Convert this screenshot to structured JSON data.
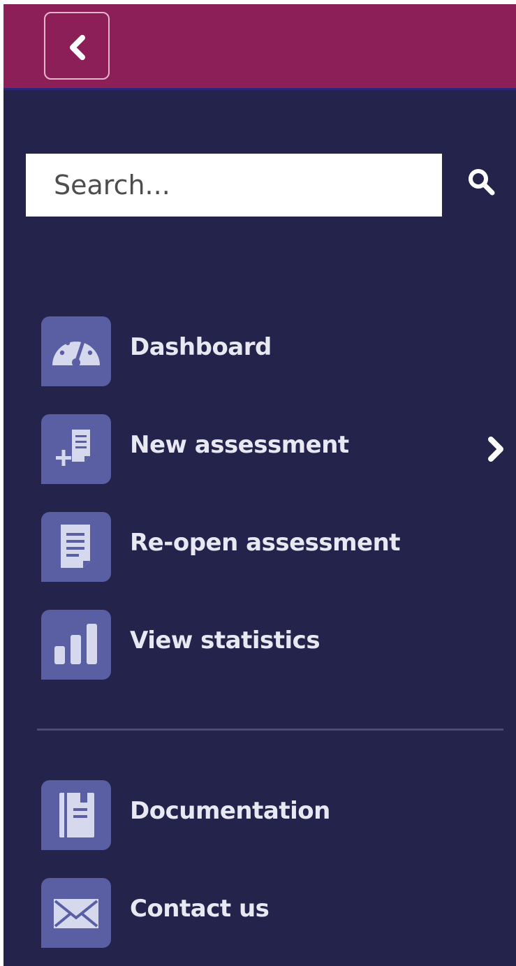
{
  "header": {
    "back_icon": "chevron-left-icon",
    "background_color": "#8c1f57"
  },
  "search": {
    "placeholder": "Search...",
    "value": "",
    "icon": "search-icon"
  },
  "menu": {
    "items": [
      {
        "label": "Dashboard",
        "icon": "dashboard-gauge-icon"
      },
      {
        "label": "New assessment",
        "icon": "new-document-icon",
        "has_submenu": true
      },
      {
        "label": "Re-open assessment",
        "icon": "document-icon"
      },
      {
        "label": "View statistics",
        "icon": "bar-chart-icon"
      }
    ],
    "secondary_items": [
      {
        "label": "Documentation",
        "icon": "notebook-icon"
      },
      {
        "label": "Contact us",
        "icon": "envelope-icon"
      }
    ]
  },
  "colors": {
    "sidebar_bg": "#24234b",
    "icon_tile_bg": "#5a5fa3",
    "text": "#e8e8f2"
  }
}
